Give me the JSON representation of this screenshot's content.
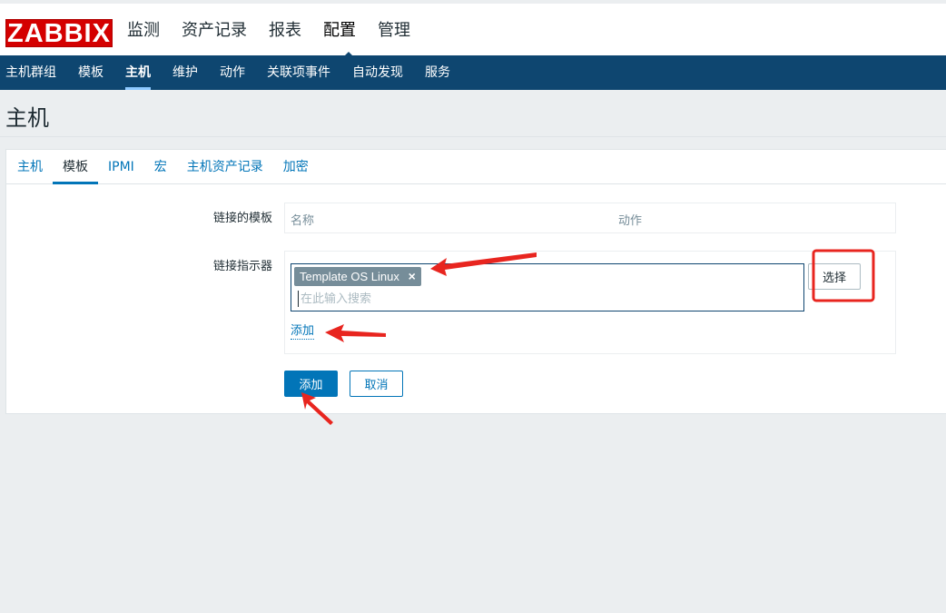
{
  "colors": {
    "page_bg": "#ebeef0",
    "nav_bg": "#0e4670",
    "link": "#0275b8",
    "logo_bg": "#d40000",
    "annotation": "#e8251f"
  },
  "logo": {
    "text": "ZABBIX"
  },
  "main_menu": [
    {
      "label": "监测"
    },
    {
      "label": "资产记录"
    },
    {
      "label": "报表"
    },
    {
      "label": "配置",
      "active": true
    },
    {
      "label": "管理"
    }
  ],
  "sub_nav": [
    {
      "label": "主机群组"
    },
    {
      "label": "模板"
    },
    {
      "label": "主机",
      "active": true
    },
    {
      "label": "维护"
    },
    {
      "label": "动作"
    },
    {
      "label": "关联项事件"
    },
    {
      "label": "自动发现"
    },
    {
      "label": "服务"
    }
  ],
  "page": {
    "title": "主机"
  },
  "tabs": [
    {
      "label": "主机"
    },
    {
      "label": "模板",
      "active": true
    },
    {
      "label": "IPMI"
    },
    {
      "label": "宏"
    },
    {
      "label": "主机资产记录"
    },
    {
      "label": "加密"
    }
  ],
  "form": {
    "linked_templates": {
      "label": "链接的模板",
      "columns": [
        "名称",
        "动作"
      ]
    },
    "link_new": {
      "label": "链接指示器",
      "selected": [
        "Template OS Linux"
      ],
      "remove_icon": "×",
      "search_placeholder": "在此输入搜索",
      "select_button": "选择",
      "add_link": "添加"
    },
    "buttons": {
      "submit": "添加",
      "cancel": "取消"
    }
  }
}
